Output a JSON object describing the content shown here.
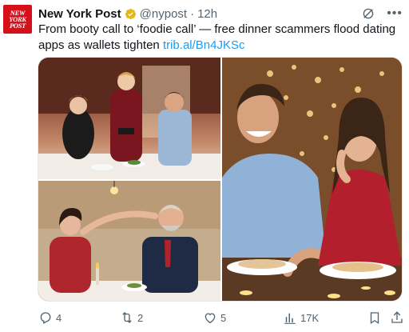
{
  "post": {
    "author_name": "New York Post",
    "avatar_text": "NEW YORK POST",
    "handle": "@nypost",
    "separator": "·",
    "time": "12h",
    "text": "From booty call to ‘foodie call’ — free dinner scammers flood dating apps as wallets tighten ",
    "link": "trib.al/Bn4JKSc"
  },
  "actions": {
    "replies": "4",
    "reposts": "2",
    "likes": "5",
    "views": "17K"
  },
  "colors": {
    "brand_red": "#d4111a",
    "link_blue": "#1d9bf0",
    "verified_gold": "#e2b719",
    "muted": "#536471"
  },
  "icons": [
    "grok-icon",
    "more-icon",
    "reply-icon",
    "repost-icon",
    "like-icon",
    "views-icon",
    "bookmark-icon",
    "share-icon"
  ]
}
